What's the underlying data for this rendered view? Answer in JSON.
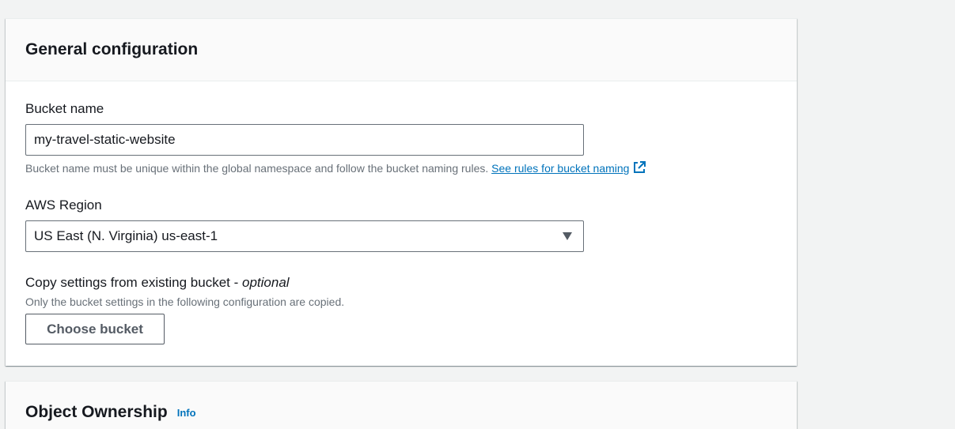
{
  "general": {
    "title": "General configuration",
    "bucket_name": {
      "label": "Bucket name",
      "value": "my-travel-static-website",
      "help_text": "Bucket name must be unique within the global namespace and follow the bucket naming rules.",
      "help_link": "See rules for bucket naming"
    },
    "region": {
      "label": "AWS Region",
      "selected": "US East (N. Virginia) us-east-1"
    },
    "copy_settings": {
      "label": "Copy settings from existing bucket - ",
      "optional": "optional",
      "help_text": "Only the bucket settings in the following configuration are copied.",
      "button_label": "Choose bucket"
    }
  },
  "ownership": {
    "title": "Object Ownership",
    "info_link": "Info"
  },
  "colors": {
    "background": "#f2f3f3",
    "link": "#0073bb",
    "text": "#16191f",
    "muted": "#687078"
  },
  "icons": {
    "external_link": "external-link-icon",
    "select_caret": "caret-down-icon"
  }
}
